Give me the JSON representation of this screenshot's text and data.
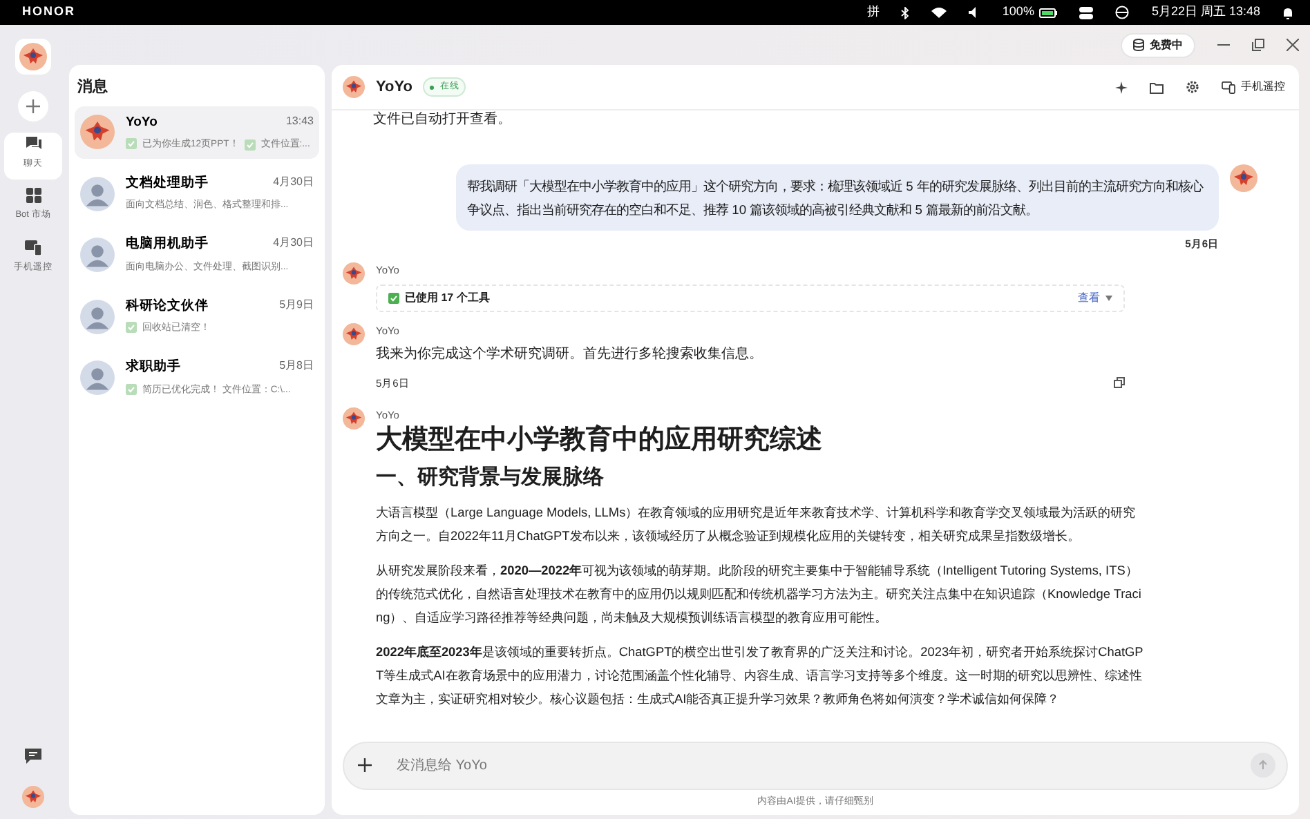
{
  "status_bar": {
    "brand": "HONOR",
    "ime": "拼",
    "battery": "100%",
    "datetime": "5月22日 周五 13:48"
  },
  "title_bar": {
    "badge": "免费中"
  },
  "rail": {
    "items": [
      {
        "label": "聊天",
        "selected": true
      },
      {
        "label": "Bot 市场",
        "selected": false
      },
      {
        "label": "手机遥控",
        "selected": false
      }
    ]
  },
  "conversations": {
    "title": "消息",
    "items": [
      {
        "name": "YoYo",
        "time": "13:43",
        "preview": "已为你生成12页PPT！",
        "preview_2": "文件位置:...",
        "done": true,
        "selected": true
      },
      {
        "name": "文档处理助手",
        "time": "4月30日",
        "preview": "面向文档总结、润色、格式整理和排...",
        "done": false,
        "selected": false
      },
      {
        "name": "电脑用机助手",
        "time": "4月30日",
        "preview": "面向电脑办公、文件处理、截图识别...",
        "done": false,
        "selected": false
      },
      {
        "name": "科研论文伙伴",
        "time": "5月9日",
        "preview": "回收站已清空！",
        "done": true,
        "selected": false
      },
      {
        "name": "求职助手",
        "time": "5月8日",
        "preview": "简历已优化完成！ 文件位置：C:\\...",
        "done": true,
        "selected": false
      }
    ]
  },
  "chat": {
    "name": "YoYo",
    "status": "在线",
    "remote_label": "手机遥控",
    "messages": [
      {
        "kind": "cut",
        "text": "文件已自动打开查看。"
      },
      {
        "kind": "user",
        "text": "帮我调研「大模型在中小学教育中的应用」这个研究方向，要求：梳理该领域近 5 年的研究发展脉络、列出目前的主流研究方向和核心争议点、指出当前研究存在的空白和不足、推荐 10 篇该领域的高被引经典文献和 5 篇最新的前沿文献。",
        "date": "5月6日"
      },
      {
        "kind": "tool",
        "sender": "YoYo",
        "text": "已使用 17 个工具",
        "action": "查看"
      },
      {
        "kind": "assistant",
        "sender": "YoYo",
        "text": "我来为你完成这个学术研究调研。首先进行多轮搜索收集信息。",
        "date": "5月6日"
      },
      {
        "kind": "document",
        "sender": "YoYo",
        "title": "大模型在中小学教育中的应用研究综述",
        "heading": "一、研究背景与发展脉络",
        "paragraphs": [
          "大语言模型（Large Language Models, LLMs）在教育领域的应用研究是近年来教育技术学、计算机科学和教育学交叉领域最为活跃的研究方向之一。自2022年11月ChatGPT发布以来，该领域经历了从概念验证到规模化应用的关键转变，相关研究成果呈指数级增长。",
          "从研究发展阶段来看，**2020—2022年**可视为该领域的萌芽期。此阶段的研究主要集中于智能辅导系统（Intelligent Tutoring Systems, ITS）的传统范式优化，自然语言处理技术在教育中的应用仍以规则匹配和传统机器学习方法为主。研究关注点集中在知识追踪（Knowledge Tracing）、自适应学习路径推荐等经典问题，尚未触及大规模预训练语言模型的教育应用可能性。",
          "**2022年底至2023年**是该领域的重要转折点。ChatGPT的横空出世引发了教育界的广泛关注和讨论。2023年初，研究者开始系统探讨ChatGPT等生成式AI在教育场景中的应用潜力，讨论范围涵盖个性化辅导、内容生成、语言学习支持等多个维度。这一时期的研究以思辨性、综述性文章为主，实证研究相对较少。核心议题包括：生成式AI能否真正提升学习效果？教师角色将如何演变？学术诚信如何保障？"
        ]
      }
    ]
  },
  "composer": {
    "placeholder": "发消息给 YoYo",
    "disclaimer": "内容由AI提供，请仔细甄别"
  }
}
